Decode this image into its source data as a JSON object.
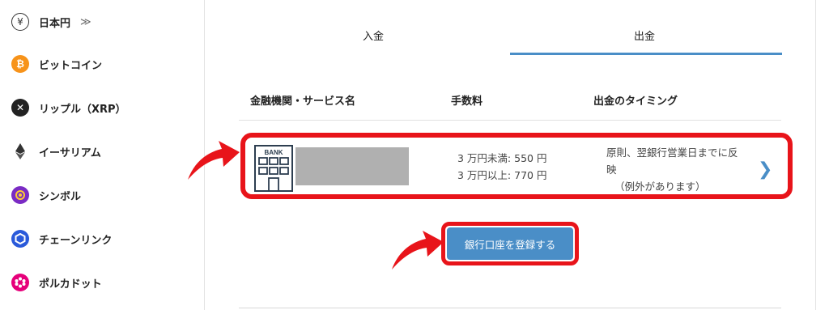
{
  "sidebar": {
    "items": [
      {
        "label": "日本円",
        "icon": "yen-icon",
        "chevron": "≫"
      },
      {
        "label": "ビットコイン",
        "icon": "bitcoin-icon"
      },
      {
        "label": "リップル（XRP）",
        "icon": "xrp-icon"
      },
      {
        "label": "イーサリアム",
        "icon": "ethereum-icon"
      },
      {
        "label": "シンボル",
        "icon": "symbol-icon"
      },
      {
        "label": "チェーンリンク",
        "icon": "chainlink-icon"
      },
      {
        "label": "ポルカドット",
        "icon": "polkadot-icon"
      }
    ]
  },
  "tabs": {
    "deposit": "入金",
    "withdraw": "出金",
    "active": "withdraw"
  },
  "table": {
    "headers": [
      "金融機関・サービス名",
      "手数料",
      "出金のタイミング"
    ],
    "row": {
      "bank_icon_text": "BANK",
      "fees": [
        "3 万円未満: 550 円",
        "3 万円以上: 770 円"
      ],
      "timing_lines": [
        "原則、翌銀行営業日までに反",
        "映"
      ],
      "timing_note": "（例外があります）"
    }
  },
  "register_button": "銀行口座を登録する",
  "colors": {
    "accent": "#4a8ec7",
    "highlight": "#e8141a",
    "bitcoin": "#f7931a",
    "symbol": "#7a2bc4",
    "chainlink": "#2a5ada",
    "polkadot": "#e6007a"
  }
}
